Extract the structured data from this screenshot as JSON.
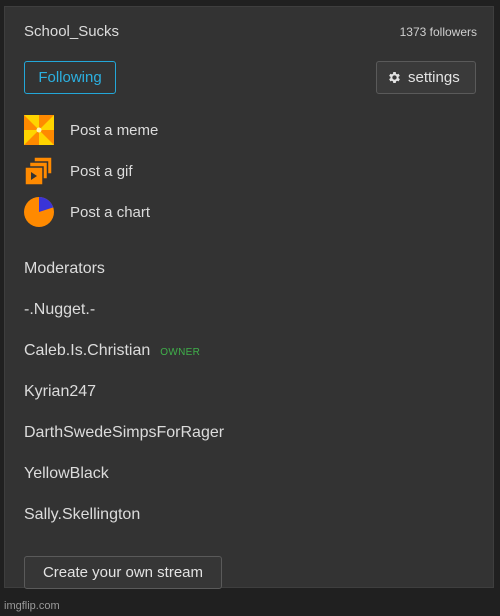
{
  "stream": {
    "name": "School_Sucks",
    "followers": "1373 followers"
  },
  "buttons": {
    "following": "Following",
    "settings": "settings",
    "create_stream": "Create your own stream"
  },
  "actions": [
    {
      "label": "Post a meme",
      "icon": "meme-icon"
    },
    {
      "label": "Post a gif",
      "icon": "gif-icon"
    },
    {
      "label": "Post a chart",
      "icon": "chart-icon"
    }
  ],
  "moderators": {
    "heading": "Moderators",
    "list": [
      {
        "name": "-.Nugget.-"
      },
      {
        "name": "Caleb.Is.Christian",
        "badge": "OWNER"
      },
      {
        "name": "Kyrian247"
      },
      {
        "name": "DarthSwedeSimpsForRager"
      },
      {
        "name": "YellowBlack"
      },
      {
        "name": "Sally.Skellington"
      }
    ]
  },
  "watermark": "imgflip.com",
  "colors": {
    "accent": "#2cb0e0",
    "owner_badge": "#3fb04a",
    "panel_bg": "#333333",
    "icon_orange": "#ff8a00"
  }
}
